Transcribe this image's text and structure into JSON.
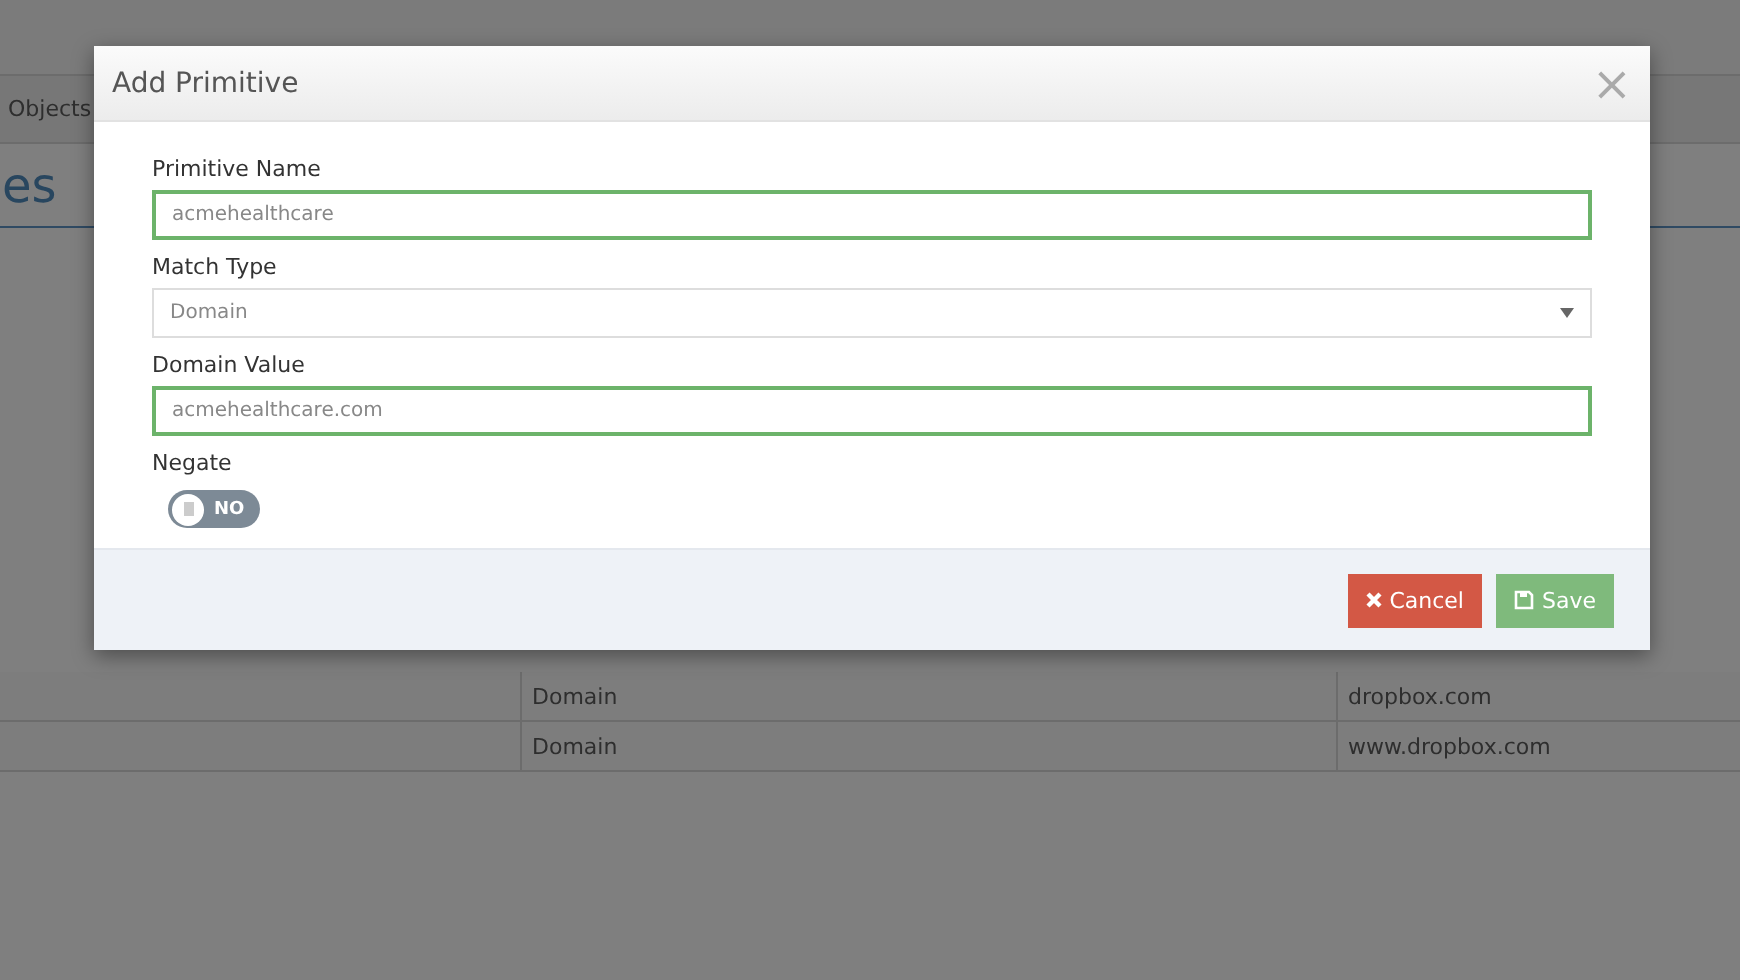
{
  "page": {
    "breadcrumb": "Objects",
    "heading": "es",
    "rows": [
      {
        "type": "Domain",
        "value": "dropbox.com"
      },
      {
        "type": "Domain",
        "value": "www.dropbox.com"
      }
    ]
  },
  "modal": {
    "title": "Add Primitive",
    "close": "×",
    "fields": [
      {
        "kind": "text",
        "label": "Primitive Name",
        "value": "acmehealthcare",
        "valid": true
      },
      {
        "kind": "select",
        "label": "Match Type",
        "value": "Domain",
        "valid": false
      },
      {
        "kind": "text",
        "label": "Domain Value",
        "value": "acmehealthcare.com",
        "valid": true
      }
    ],
    "toggle": {
      "label": "Negate",
      "on": false,
      "text": "NO"
    },
    "buttons": [
      {
        "kind": "cancel",
        "label": "Cancel"
      },
      {
        "kind": "save",
        "label": "Save"
      }
    ]
  }
}
